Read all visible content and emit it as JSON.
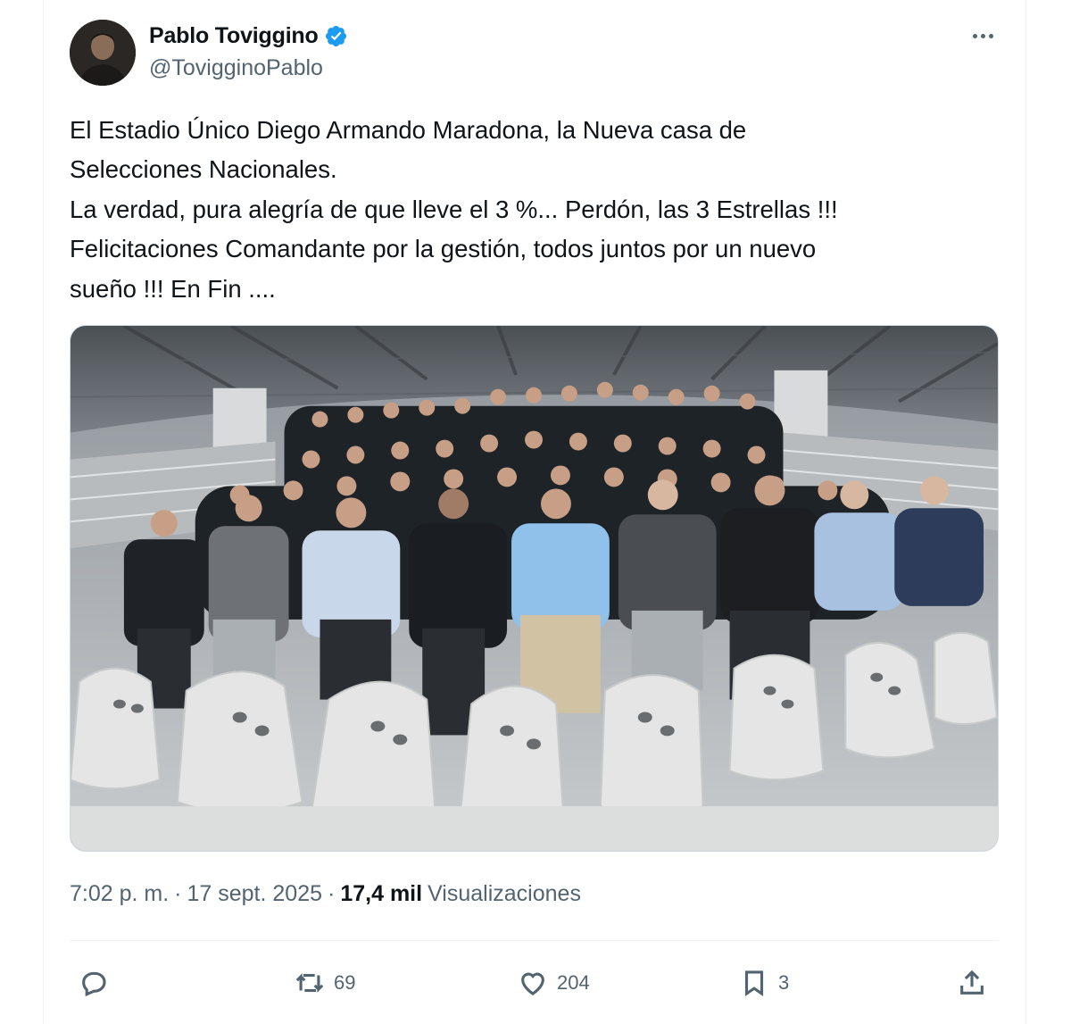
{
  "author": {
    "display_name": "Pablo Toviggino",
    "handle": "@TovigginoPablo",
    "verified_icon": "verified-badge-icon",
    "avatar_icon": "avatar"
  },
  "menu": {
    "more_icon": "more-icon"
  },
  "tweet": {
    "lines": [
      "El Estadio Único Diego Armando Maradona, la Nueva casa de",
      "Selecciones Nacionales.",
      "La verdad, pura alegría de que lleve el 3 %... Perdón, las 3 Estrellas !!!",
      "Felicitaciones Comandante por la gestión, todos juntos por un nuevo",
      "sueño !!! En Fin ...."
    ]
  },
  "media": {
    "kind": "photo"
  },
  "meta": {
    "time": "7:02 p. m.",
    "separator": "·",
    "date": "17 sept. 2025",
    "views_count": "17,4 mil",
    "views_label": "Visualizaciones"
  },
  "actions": {
    "reply": {
      "icon": "reply-icon",
      "count": ""
    },
    "retweet": {
      "icon": "retweet-icon",
      "count": "69"
    },
    "like": {
      "icon": "heart-icon",
      "count": "204"
    },
    "bookmark": {
      "icon": "bookmark-icon",
      "count": "3"
    },
    "share": {
      "icon": "share-icon",
      "count": ""
    }
  },
  "colors": {
    "primary_text": "#0f1419",
    "secondary_text": "#536471",
    "verified": "#1d9bf0",
    "border": "#eff3f4"
  }
}
